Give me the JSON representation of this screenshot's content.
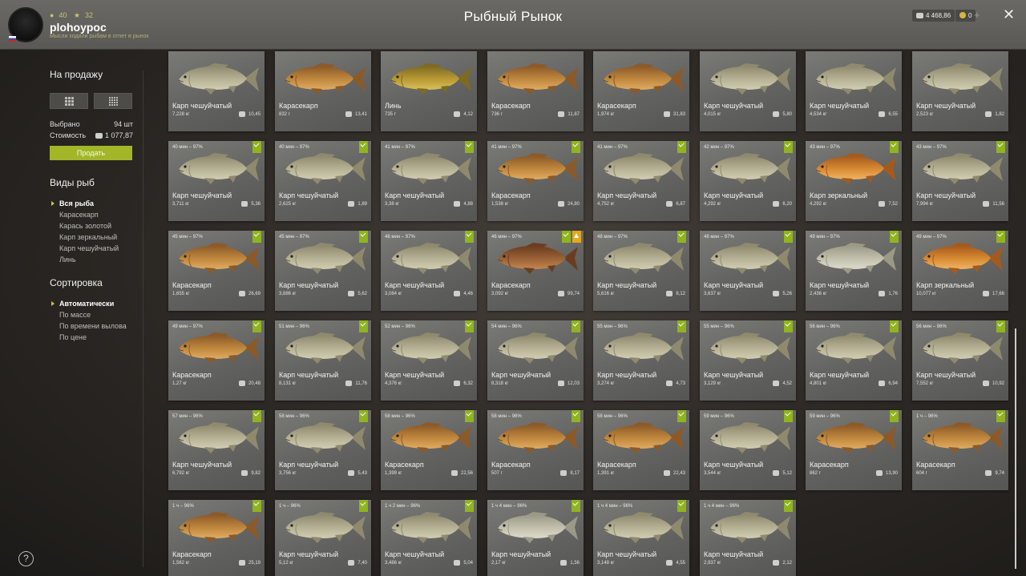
{
  "header": {
    "title": "Рыбный Рынок",
    "player": {
      "name": "plohoypoc",
      "stat_a": "40",
      "stat_b": "32",
      "status": "Мысли ходили рыбам в отпет в рынок"
    },
    "money": "4 468,86",
    "gold": "0",
    "plus": "+",
    "close": "✕"
  },
  "sidebar": {
    "for_sale_title": "На продажу",
    "selected_label": "Выбрано",
    "selected_value": "94 шт",
    "cost_label": "Стоимость",
    "cost_value": "1 077,87",
    "sell_button": "Продать",
    "fish_types_title": "Виды рыб",
    "fish_types": [
      "Вся рыба",
      "Карасекарп",
      "Карась золотой",
      "Карп зеркальный",
      "Карп чешуйчатый",
      "Линь"
    ],
    "sort_title": "Сортировка",
    "sort_options": [
      "Автоматически",
      "По массе",
      "По времени вылова",
      "По цене"
    ],
    "help": "?"
  },
  "colors": {
    "accent": "#a2b628",
    "badge_green": "#8fb41f",
    "badge_gold": "#e3a81f",
    "fish_scaly": "#b3ad8f",
    "fish_crucian": "#c0883e",
    "fish_tench": "#b99a35",
    "fish_mirror": "#d88a32"
  },
  "rows": [
    [
      {
        "name": "Карп чешуйчатый",
        "weight": "7,228 кг",
        "price": "10,45",
        "time": "",
        "kind": "scaly"
      },
      {
        "name": "Карасекарп",
        "weight": "832 г",
        "price": "13,41",
        "time": "",
        "kind": "crucian"
      },
      {
        "name": "Линь",
        "weight": "735 г",
        "price": "4,12",
        "time": "",
        "kind": "tench"
      },
      {
        "name": "Карасекарп",
        "weight": "736 г",
        "price": "11,87",
        "time": "",
        "kind": "crucian"
      },
      {
        "name": "Карасекарп",
        "weight": "1,974 кг",
        "price": "31,83",
        "time": "",
        "kind": "crucian"
      },
      {
        "name": "Карп чешуйчатый",
        "weight": "4,015 кг",
        "price": "5,80",
        "time": "",
        "kind": "scaly"
      },
      {
        "name": "Карп чешуйчатый",
        "weight": "4,534 кг",
        "price": "6,55",
        "time": "",
        "kind": "scaly"
      },
      {
        "name": "Карп чешуйчатый",
        "weight": "2,523 кг",
        "price": "1,82",
        "time": "",
        "kind": "scaly"
      }
    ],
    [
      {
        "name": "Карп чешуйчатый",
        "weight": "3,711 кг",
        "price": "5,36",
        "time": "40 мин – 97%",
        "kind": "scaly"
      },
      {
        "name": "Карп чешуйчатый",
        "weight": "2,625 кг",
        "price": "1,89",
        "time": "40 мин – 97%",
        "kind": "scaly"
      },
      {
        "name": "Карп чешуйчатый",
        "weight": "3,38 кг",
        "price": "4,88",
        "time": "41 мин – 97%",
        "kind": "scaly"
      },
      {
        "name": "Карасекарп",
        "weight": "1,538 кг",
        "price": "24,80",
        "time": "41 мин – 97%",
        "kind": "crucian"
      },
      {
        "name": "Карп чешуйчатый",
        "weight": "4,752 кг",
        "price": "6,87",
        "time": "41 мин – 97%",
        "kind": "scaly"
      },
      {
        "name": "Карп чешуйчатый",
        "weight": "4,292 кг",
        "price": "6,20",
        "time": "42 мин – 97%",
        "kind": "scaly"
      },
      {
        "name": "Карп зеркальный",
        "weight": "4,292 кг",
        "price": "7,52",
        "time": "43 мин – 97%",
        "kind": "mirror"
      },
      {
        "name": "Карп чешуйчатый",
        "weight": "7,994 кг",
        "price": "11,56",
        "time": "43 мин – 97%",
        "kind": "scaly"
      }
    ],
    [
      {
        "name": "Карасекарп",
        "weight": "1,655 кг",
        "price": "26,69",
        "time": "45 мин – 97%",
        "kind": "crucian"
      },
      {
        "name": "Карп чешуйчатый",
        "weight": "3,886 кг",
        "price": "5,62",
        "time": "45 мин – 97%",
        "kind": "scaly"
      },
      {
        "name": "Карп чешуйчатый",
        "weight": "3,084 кг",
        "price": "4,46",
        "time": "46 мин – 97%",
        "kind": "scaly"
      },
      {
        "name": "Карасекарп",
        "weight": "3,092 кг",
        "price": "99,74",
        "time": "46 мин – 97%",
        "kind": "crucian_dark",
        "gold": true
      },
      {
        "name": "Карп чешуйчатый",
        "weight": "5,616 кг",
        "price": "8,12",
        "time": "48 мин – 97%",
        "kind": "scaly"
      },
      {
        "name": "Карп чешуйчатый",
        "weight": "3,637 кг",
        "price": "5,26",
        "time": "48 мин – 97%",
        "kind": "scaly"
      },
      {
        "name": "Карп чешуйчатый",
        "weight": "2,436 кг",
        "price": "1,76",
        "time": "49 мин – 97%",
        "kind": "scaly_light"
      },
      {
        "name": "Карп зеркальный",
        "weight": "10,077 кг",
        "price": "17,66",
        "time": "49 мин – 97%",
        "kind": "mirror"
      }
    ],
    [
      {
        "name": "Карасекарп",
        "weight": "1,27 кг",
        "price": "20,48",
        "time": "49 мин – 97%",
        "kind": "crucian"
      },
      {
        "name": "Карп чешуйчатый",
        "weight": "8,131 кг",
        "price": "11,76",
        "time": "51 мин – 96%",
        "kind": "scaly"
      },
      {
        "name": "Карп чешуйчатый",
        "weight": "4,376 кг",
        "price": "6,32",
        "time": "52 мин – 96%",
        "kind": "scaly"
      },
      {
        "name": "Карп чешуйчатый",
        "weight": "8,318 кг",
        "price": "12,03",
        "time": "54 мин – 96%",
        "kind": "scaly"
      },
      {
        "name": "Карп чешуйчатый",
        "weight": "3,274 кг",
        "price": "4,73",
        "time": "55 мин – 96%",
        "kind": "scaly"
      },
      {
        "name": "Карп чешуйчатый",
        "weight": "3,129 кг",
        "price": "4,52",
        "time": "55 мин – 96%",
        "kind": "scaly"
      },
      {
        "name": "Карп чешуйчатый",
        "weight": "4,801 кг",
        "price": "6,94",
        "time": "56 мин – 96%",
        "kind": "scaly"
      },
      {
        "name": "Карп чешуйчатый",
        "weight": "7,552 кг",
        "price": "10,92",
        "time": "56 мин – 96%",
        "kind": "scaly"
      }
    ],
    [
      {
        "name": "Карп чешуйчатый",
        "weight": "6,792 кг",
        "price": "9,82",
        "time": "57 мин – 96%",
        "kind": "scaly"
      },
      {
        "name": "Карп чешуйчатый",
        "weight": "3,756 кг",
        "price": "5,43",
        "time": "58 мин – 96%",
        "kind": "scaly"
      },
      {
        "name": "Карасекарп",
        "weight": "1,399 кг",
        "price": "22,56",
        "time": "58 мин – 96%",
        "kind": "crucian"
      },
      {
        "name": "Карасекарп",
        "weight": "507 г",
        "price": "8,17",
        "time": "58 мин – 96%",
        "kind": "crucian"
      },
      {
        "name": "Карасекарп",
        "weight": "1,391 кг",
        "price": "22,43",
        "time": "58 мин – 96%",
        "kind": "crucian"
      },
      {
        "name": "Карп чешуйчатый",
        "weight": "3,544 кг",
        "price": "5,12",
        "time": "59 мин – 96%",
        "kind": "scaly"
      },
      {
        "name": "Карасекарп",
        "weight": "862 г",
        "price": "13,90",
        "time": "59 мин – 96%",
        "kind": "crucian"
      },
      {
        "name": "Карасекарп",
        "weight": "604 г",
        "price": "9,74",
        "time": "1 ч – 96%",
        "kind": "crucian"
      }
    ],
    [
      {
        "name": "Карасекарп",
        "weight": "1,562 кг",
        "price": "25,19",
        "time": "1 ч – 96%",
        "kind": "crucian"
      },
      {
        "name": "Карп чешуйчатый",
        "weight": "5,12 кг",
        "price": "7,40",
        "time": "1 ч – 96%",
        "kind": "scaly"
      },
      {
        "name": "Карп чешуйчатый",
        "weight": "3,486 кг",
        "price": "5,04",
        "time": "1 ч 2 мин – 96%",
        "kind": "scaly"
      },
      {
        "name": "Карп чешуйчатый",
        "weight": "2,17 кг",
        "price": "1,56",
        "time": "1 ч 4 мин – 96%",
        "kind": "scaly_light"
      },
      {
        "name": "Карп чешуйчатый",
        "weight": "3,148 кг",
        "price": "4,55",
        "time": "1 ч 4 мин – 96%",
        "kind": "scaly"
      },
      {
        "name": "Карп чешуйчатый",
        "weight": "2,937 кг",
        "price": "2,12",
        "time": "1 ч 4 мин – 96%",
        "kind": "scaly"
      }
    ]
  ]
}
